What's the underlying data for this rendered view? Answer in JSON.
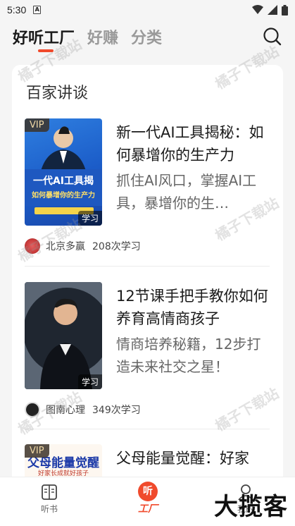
{
  "status_bar": {
    "time": "5:30",
    "sim_label": "A"
  },
  "top_nav": {
    "tabs": [
      {
        "label": "好听工厂",
        "active": true
      },
      {
        "label": "好赚",
        "active": false
      },
      {
        "label": "分类",
        "active": false
      }
    ],
    "accent_color": "#f04a2c"
  },
  "section": {
    "title": "百家讲谈",
    "courses": [
      {
        "vip": "VIP",
        "badge": "学习",
        "title": "新一代AI工具揭秘：如何暴增你的生产力",
        "desc": "抓住AI风口，掌握AI工具，暴增你的生…",
        "author": "北京多赢",
        "count": "208次学习",
        "thumb_text_1": "一代AI工具揭",
        "thumb_text_2": "如何暴增你的生产力"
      },
      {
        "vip": "",
        "badge": "学习",
        "title": "12节课手把手教你如何养育高情商孩子",
        "desc": "情商培养秘籍，12步打造未来社交之星！",
        "author": "图南心理",
        "count": "349次学习"
      },
      {
        "vip": "VIP",
        "badge": "",
        "title": "父母能量觉醒：好家",
        "thumb_text_1": "父母能量觉醒",
        "thumb_text_2": "好家长成就好孩子"
      }
    ]
  },
  "watermark": "橘子下载站",
  "bottom_nav": {
    "items": [
      {
        "label": "听书",
        "icon": "book-icon"
      },
      {
        "label": "工厂",
        "icon": "listen-icon",
        "icon_text": "听",
        "active": true
      },
      {
        "label": "我的",
        "icon": "profile-icon"
      }
    ],
    "logo": "大揽客"
  }
}
